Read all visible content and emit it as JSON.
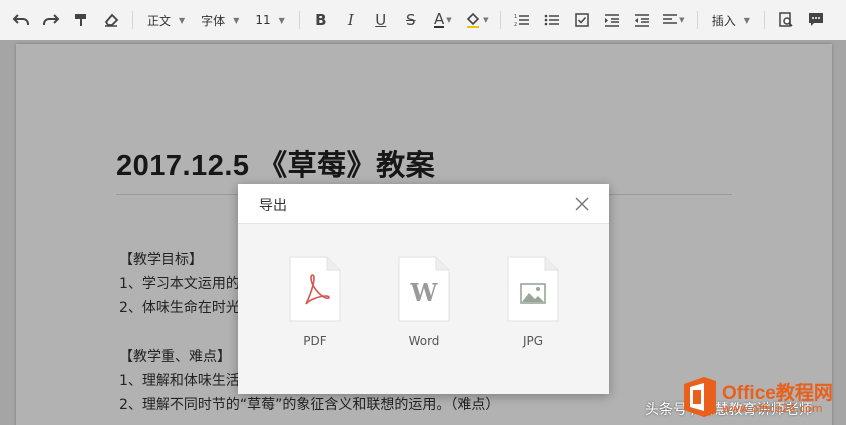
{
  "toolbar": {
    "paragraph_style": "正文",
    "font_family": "字体",
    "font_size": "11",
    "insert_label": "插入",
    "bold_glyph": "B",
    "italic_glyph": "I",
    "underline_glyph": "U",
    "strike_glyph": "S",
    "font_color_glyph": "A"
  },
  "document": {
    "title": "2017.12.5 《草莓》教案",
    "lines": [
      "【教学目标】",
      "1、学习本文运用的",
      "2、体味生命在时光",
      "",
      "【教学重、难点】",
      "1、理解和体味生活",
      "2、理解不同时节的“草莓”的象征含义和联想的运用。（难点）"
    ]
  },
  "export_dialog": {
    "title": "导出",
    "options": [
      {
        "label": "PDF",
        "icon": "pdf-icon",
        "glyph": "",
        "color": "#d9534f"
      },
      {
        "label": "Word",
        "icon": "word-icon",
        "glyph": "W",
        "color": "#9a9a9a"
      },
      {
        "label": "JPG",
        "icon": "jpg-icon",
        "glyph": "",
        "color": "#9aa59a"
      }
    ]
  },
  "watermark": {
    "headline_source": "头条号 / 智慧教育讲师老师",
    "brand": "Office教程网",
    "url": "www.office26.com"
  }
}
